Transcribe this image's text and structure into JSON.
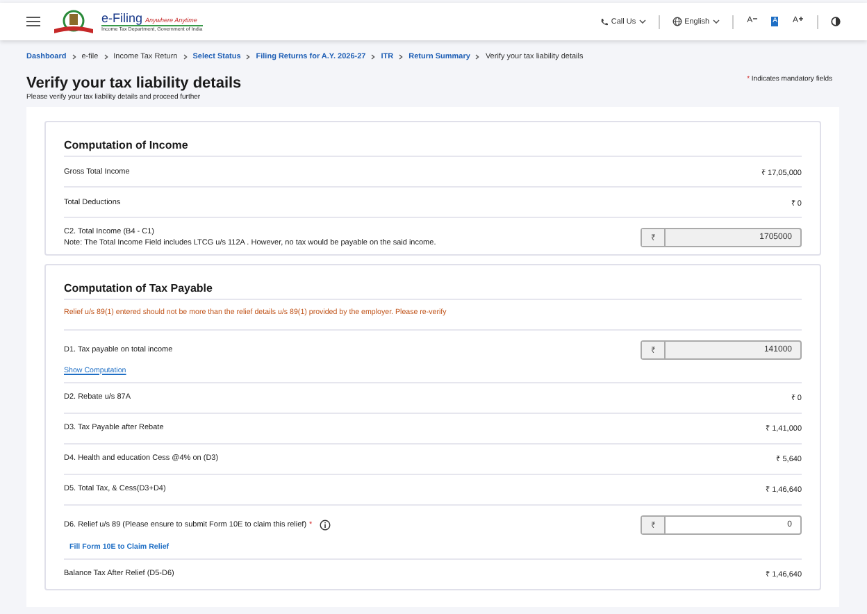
{
  "header": {
    "logo_title": "e-Filing",
    "logo_tagline": "Anywhere Anytime",
    "logo_subtitle": "Income Tax Department, Government of India",
    "call_us": "Call Us",
    "language": "English",
    "font_decrease": "A",
    "font_reset": "A",
    "font_increase": "A"
  },
  "breadcrumb": [
    {
      "label": "Dashboard",
      "link": true
    },
    {
      "label": "e-file",
      "link": false
    },
    {
      "label": "Income Tax Return",
      "link": false
    },
    {
      "label": "Select Status",
      "link": true
    },
    {
      "label": "Filing Returns for A.Y. 2026-27",
      "link": true
    },
    {
      "label": "ITR",
      "link": true
    },
    {
      "label": "Return Summary",
      "link": true
    },
    {
      "label": "Verify your tax liability details",
      "link": false
    }
  ],
  "page": {
    "title": "Verify your tax liability details",
    "subtitle": "Please verify your tax liability details and proceed further",
    "mandatory_mark": "*",
    "mandatory_note": "Indicates mandatory fields"
  },
  "sections": [
    {
      "title": "Computation of Income",
      "rows": [
        {
          "kind": "amount",
          "label": "Gross Total Income",
          "value": "₹ 17,05,000"
        },
        {
          "kind": "amount",
          "label": "Total Deductions",
          "value": "₹ 0"
        },
        {
          "kind": "field",
          "label": "C2. Total Income (B4 - C1)",
          "note": "Note: The Total Income Field includes LTCG u/s 112A . However, no tax would be payable on the said income.",
          "currency": "₹",
          "value": "1705000",
          "disabled": true,
          "required": false,
          "info": false
        }
      ]
    },
    {
      "title": "Computation of Tax Payable",
      "rows": [
        {
          "kind": "notice",
          "text": "Relief u/s 89(1) entered should not be more than the relief details u/s 89(1) provided by the employer. Please re-verify"
        },
        {
          "kind": "field",
          "label": "D1. Tax payable on total income",
          "link": "Show Computation",
          "currency": "₹",
          "value": "141000",
          "disabled": true,
          "required": false,
          "info": false
        },
        {
          "kind": "amount",
          "label": "D2. Rebate u/s 87A",
          "value": "₹ 0"
        },
        {
          "kind": "amount",
          "label": "D3. Tax Payable after Rebate",
          "value": "₹ 1,41,000"
        },
        {
          "kind": "amount",
          "label": "D4. Health and education Cess @4% on (D3)",
          "value": "₹ 5,640"
        },
        {
          "kind": "amount",
          "label": "D5. Total Tax, & Cess(D3+D4)",
          "value": "₹ 1,46,640"
        },
        {
          "kind": "field",
          "label": "D6. Relief u/s 89 (Please ensure to submit Form 10E to claim this relief)",
          "action": "Fill Form 10E to Claim Relief",
          "currency": "₹",
          "value": "0",
          "disabled": false,
          "required": true,
          "info": true
        },
        {
          "kind": "amount",
          "label": "Balance Tax After Relief (D5-D6)",
          "value": "₹ 1,46,640"
        }
      ]
    }
  ]
}
